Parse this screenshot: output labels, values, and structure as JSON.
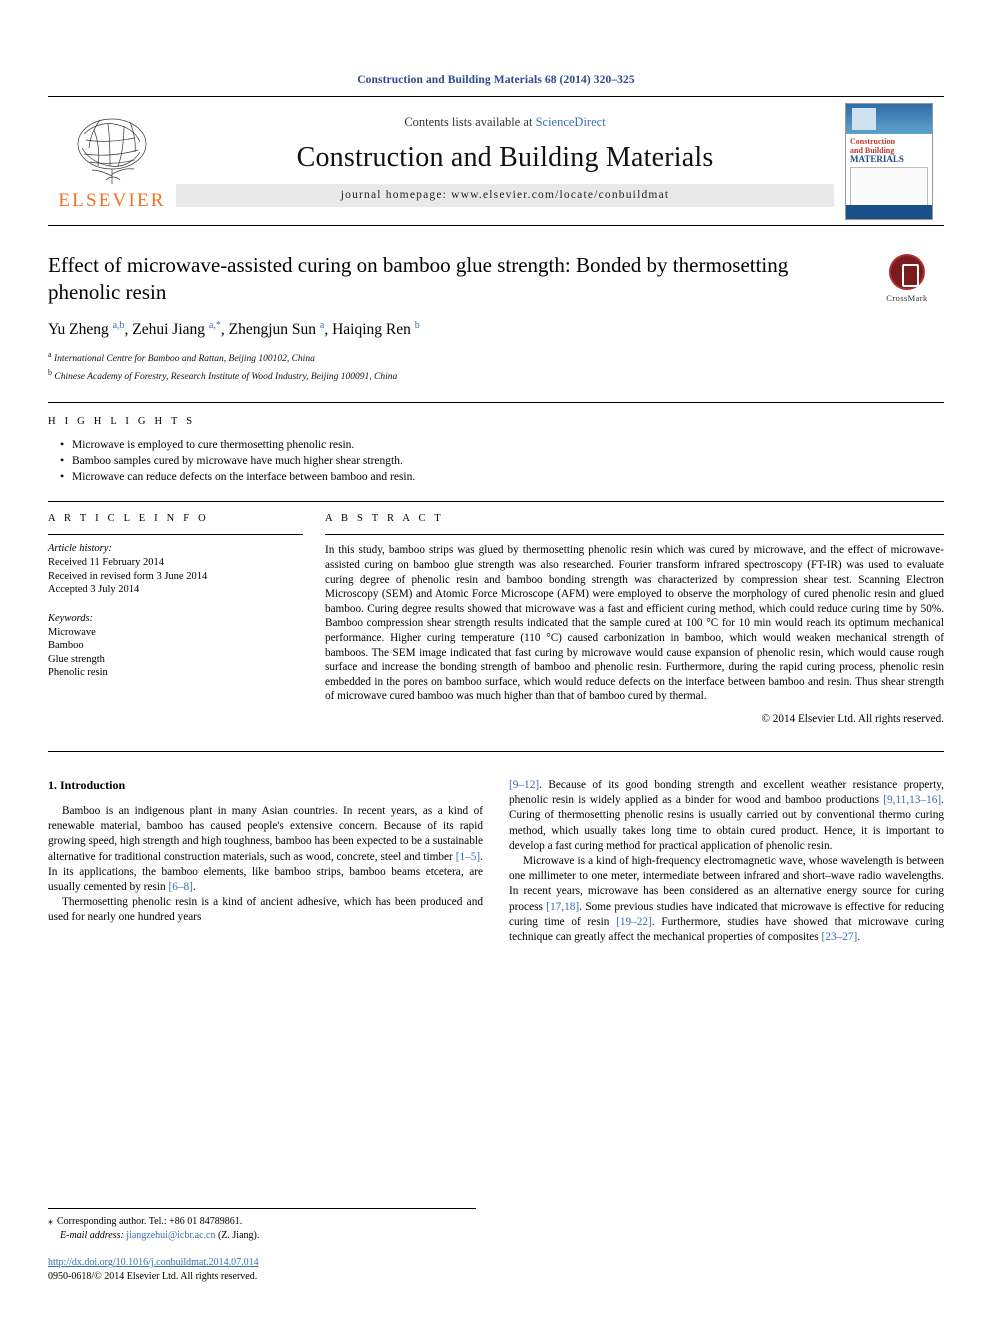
{
  "running_head": "Construction and Building Materials 68 (2014) 320–325",
  "masthead": {
    "publisher": "ELSEVIER",
    "contents_prefix": "Contents lists available at ",
    "contents_link": "ScienceDirect",
    "journal_title": "Construction and Building Materials",
    "homepage": "journal homepage: www.elsevier.com/locate/conbuildmat",
    "cover": {
      "line1": "Construction",
      "line2": "and Building",
      "line3": "MATERIALS"
    }
  },
  "article": {
    "title": "Effect of microwave-assisted curing on bamboo glue strength: Bonded by thermosetting phenolic resin",
    "authors": "Yu Zheng a,b, Zehui Jiang a,*, Zhengjun Sun a, Haiqing Ren b",
    "affiliation_a": "a International Centre for Bamboo and Rattan, Beijing 100102, China",
    "affiliation_b": "b Chinese Academy of Forestry, Research Institute of Wood Industry, Beijing 100091, China",
    "crossmark_label": "CrossMark"
  },
  "highlights": {
    "heading": "H I G H L I G H T S",
    "items": [
      "Microwave is employed to cure thermosetting phenolic resin.",
      "Bamboo samples cured by microwave have much higher shear strength.",
      "Microwave can reduce defects on the interface between bamboo and resin."
    ]
  },
  "article_info": {
    "heading": "A R T I C L E   I N F O",
    "history_label": "Article history:",
    "history": [
      "Received 11 February 2014",
      "Received in revised form 3 June 2014",
      "Accepted 3 July 2014"
    ],
    "keywords_label": "Keywords:",
    "keywords": [
      "Microwave",
      "Bamboo",
      "Glue strength",
      "Phenolic resin"
    ]
  },
  "abstract": {
    "heading": "A B S T R A C T",
    "text": "In this study, bamboo strips was glued by thermosetting phenolic resin which was cured by microwave, and the effect of microwave-assisted curing on bamboo glue strength was also researched. Fourier transform infrared spectroscopy (FT-IR) was used to evaluate curing degree of phenolic resin and bamboo bonding strength was characterized by compression shear test. Scanning Electron Microscopy (SEM) and Atomic Force Microscope (AFM) were employed to observe the morphology of cured phenolic resin and glued bamboo. Curing degree results showed that microwave was a fast and efficient curing method, which could reduce curing time by 50%. Bamboo compression shear strength results indicated that the sample cured at 100 °C for 10 min would reach its optimum mechanical performance. Higher curing temperature (110 °C) caused carbonization in bamboo, which would weaken mechanical strength of bamboos. The SEM image indicated that fast curing by microwave would cause expansion of phenolic resin, which would cause rough surface and increase the bonding strength of bamboo and phenolic resin. Furthermore, during the rapid curing process, phenolic resin embedded in the pores on bamboo surface, which would reduce defects on the interface between bamboo and resin. Thus shear strength of microwave cured bamboo was much higher than that of bamboo cured by thermal.",
    "copyright": "© 2014 Elsevier Ltd. All rights reserved."
  },
  "body": {
    "section_title": "1. Introduction",
    "left_paragraphs": [
      "Bamboo is an indigenous plant in many Asian countries. In recent years, as a kind of renewable material, bamboo has caused people's extensive concern. Because of its rapid growing speed, high strength and high toughness, bamboo has been expected to be a sustainable alternative for traditional construction materials, such as wood, concrete, steel and timber [1–5]. In its applications, the bamboo elements, like bamboo strips, bamboo beams etcetera, are usually cemented by resin [6–8].",
      "Thermosetting phenolic resin is a kind of ancient adhesive, which has been produced and used for nearly one hundred years"
    ],
    "right_paragraphs": [
      "[9–12]. Because of its good bonding strength and excellent weather resistance property, phenolic resin is widely applied as a binder for wood and bamboo productions [9,11,13–16]. Curing of thermosetting phenolic resins is usually carried out by conventional thermo curing method, which usually takes long time to obtain cured product. Hence, it is important to develop a fast curing method for practical application of phenolic resin.",
      "Microwave is a kind of high-frequency electromagnetic wave, whose wavelength is between one millimeter to one meter, intermediate between infrared and short–wave radio wavelengths. In recent years, microwave has been considered as an alternative energy source for curing process [17,18]. Some previous studies have indicated that microwave is effective for reducing curing time of resin [19–22]. Furthermore, studies have showed that microwave curing technique can greatly affect the mechanical properties of composites [23–27]."
    ]
  },
  "footer": {
    "corresponding": "Corresponding author. Tel.: +86 01 84789861.",
    "email_label": "E-mail address:",
    "email": "jiangzehui@icbr.ac.cn",
    "email_person": "(Z. Jiang).",
    "doi": "http://dx.doi.org/10.1016/j.conbuildmat.2014.07.014",
    "issn": "0950-0618/© 2014 Elsevier Ltd. All rights reserved."
  },
  "colors": {
    "link": "#3a6fb0",
    "elsevier_orange": "#f27024",
    "running_head": "#2b4c8c"
  }
}
